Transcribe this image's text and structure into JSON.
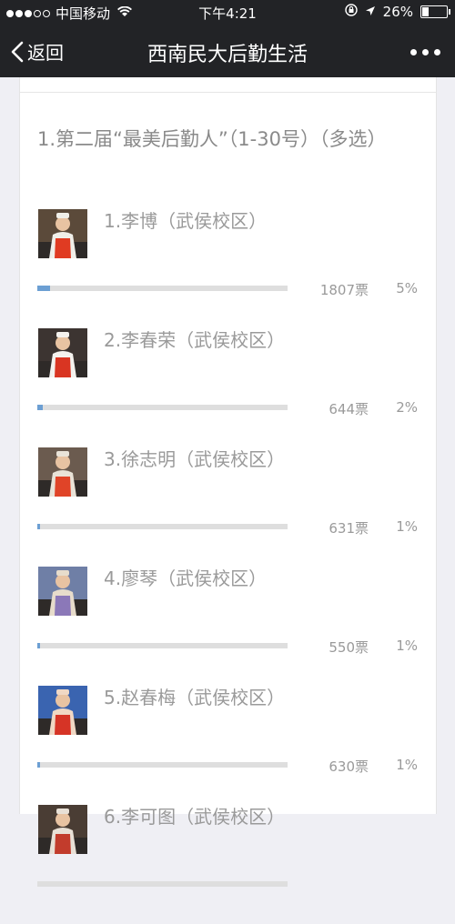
{
  "status": {
    "carrier": "中国移动",
    "time": "下午4:21",
    "battery": "26%",
    "battery_level": 0.26
  },
  "nav": {
    "back_label": "返回",
    "title": "西南民大后勤生活"
  },
  "question": "1.第二届“最美后勤人”（1-30号）（多选）",
  "options": [
    {
      "label": "1.李博（武侯校区）",
      "votes": "1807票",
      "percent": "5%",
      "fill": 0.05
    },
    {
      "label": "2.李春荣（武侯校区）",
      "votes": "644票",
      "percent": "2%",
      "fill": 0.02
    },
    {
      "label": "3.徐志明（武侯校区）",
      "votes": "631票",
      "percent": "1%",
      "fill": 0.01
    },
    {
      "label": "4.廖琴（武侯校区）",
      "votes": "550票",
      "percent": "1%",
      "fill": 0.01
    },
    {
      "label": "5.赵春梅（武侯校区）",
      "votes": "630票",
      "percent": "1%",
      "fill": 0.01
    },
    {
      "label": "6.李可图（武侯校区）",
      "votes": "",
      "percent": "",
      "fill": 0
    }
  ],
  "colors": {
    "bar_fill": "#6c9fd3",
    "bar_track": "#dedede",
    "nav_bg": "#222326"
  }
}
